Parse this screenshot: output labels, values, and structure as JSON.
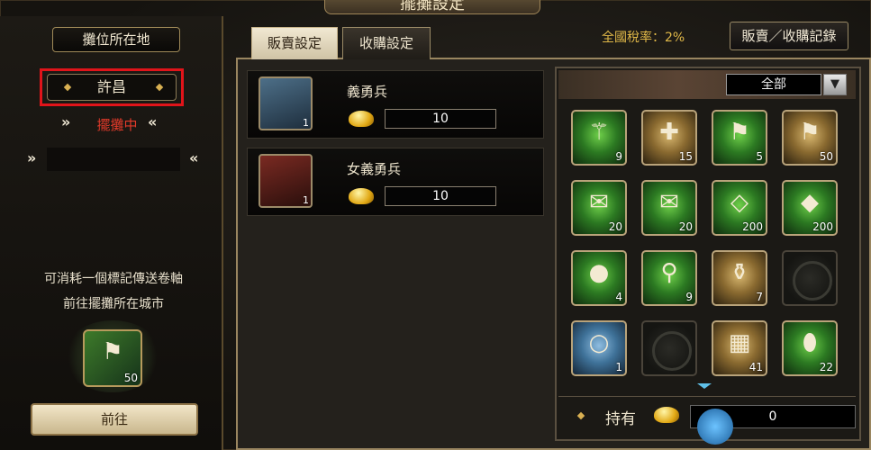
{
  "banner": {
    "title": "擺攤設定"
  },
  "left": {
    "stall_label": "攤位所在地",
    "city": "許昌",
    "status_text": "擺攤中",
    "hint_line1": "可消耗一個標記傳送卷軸",
    "hint_line2": "前往擺攤所在城市",
    "scroll_qty": "50",
    "go_button": "前往"
  },
  "tabs": {
    "sell": "販賣設定",
    "buy": "收購設定"
  },
  "tax": {
    "label": "全國稅率：2%"
  },
  "record_button": "販賣／收購記錄",
  "listings": [
    {
      "name": "義勇兵",
      "count": "1",
      "price": "10"
    },
    {
      "name": "女義勇兵",
      "count": "1",
      "price": "10"
    }
  ],
  "inventory": {
    "filter": "全部",
    "items": [
      {
        "icon": "branch-icon",
        "qty": "9"
      },
      {
        "icon": "bandage-icon",
        "qty": "15"
      },
      {
        "icon": "flag-spear-icon",
        "qty": "5"
      },
      {
        "icon": "teleport-scroll-icon",
        "qty": "50"
      },
      {
        "icon": "scroll-bundle-icon",
        "qty": "20"
      },
      {
        "icon": "paper-roll-icon",
        "qty": "20"
      },
      {
        "icon": "white-cloth-icon",
        "qty": "200"
      },
      {
        "icon": "iron-plate-icon",
        "qty": "200"
      },
      {
        "icon": "stone-orb-icon",
        "qty": "4"
      },
      {
        "icon": "bone-icon",
        "qty": "9"
      },
      {
        "icon": "water-bucket-icon",
        "qty": "7"
      },
      {
        "icon": "empty-slot-icon",
        "qty": ""
      },
      {
        "icon": "silver-bracelet-icon",
        "qty": "1"
      },
      {
        "icon": "empty-slot-icon",
        "qty": ""
      },
      {
        "icon": "ore-box-icon",
        "qty": "41"
      },
      {
        "icon": "jade-icon",
        "qty": "22"
      }
    ],
    "own_label": "持有",
    "own_value": "0"
  },
  "colors": {
    "accent": "#e0b848",
    "status_red": "#e23a2a",
    "highlight_box": "#e0141a"
  }
}
